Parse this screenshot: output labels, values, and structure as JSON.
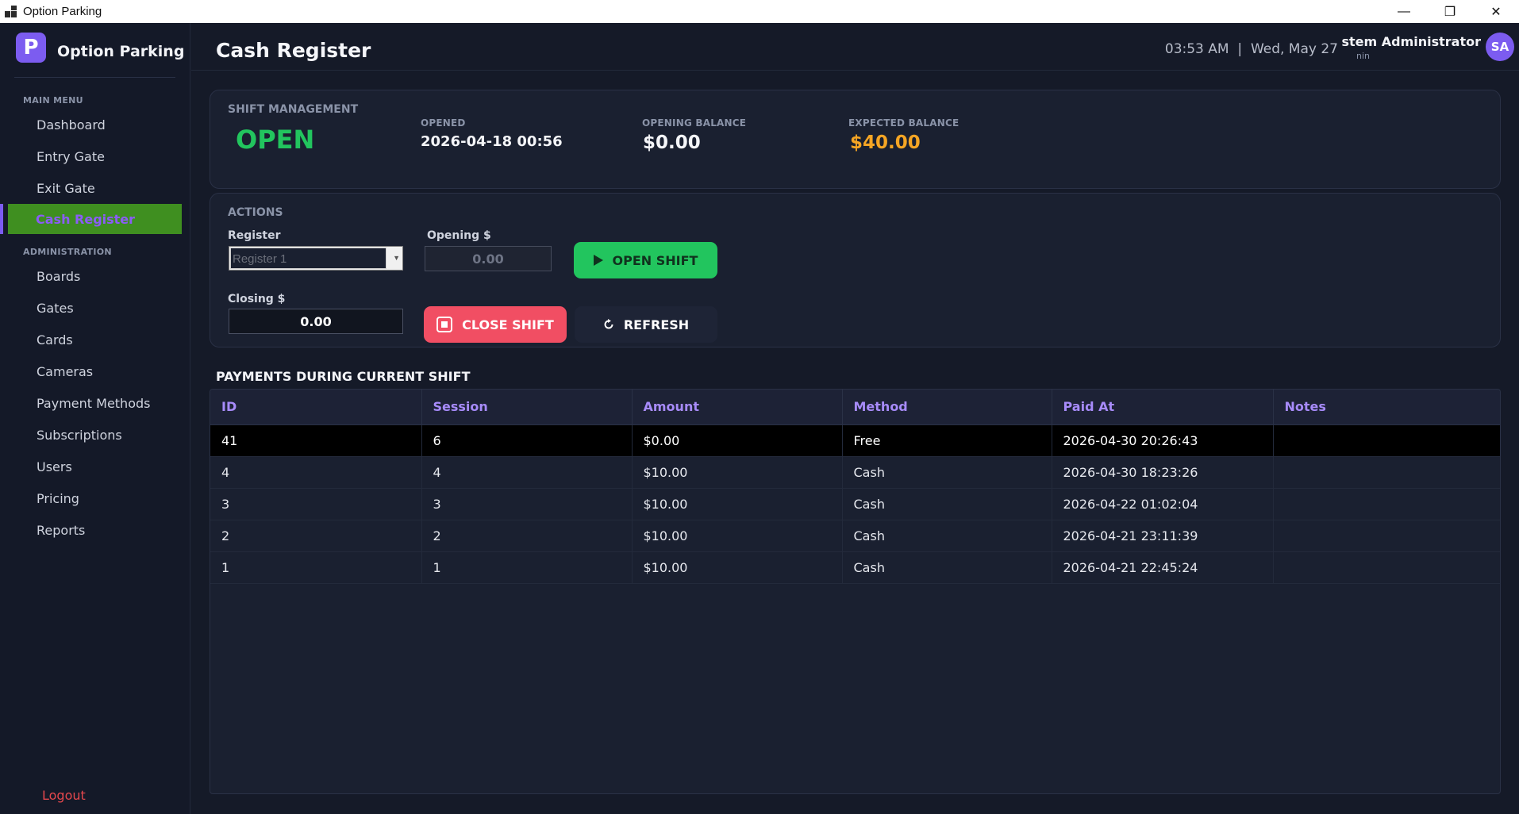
{
  "window": {
    "title": "Option Parking",
    "controls": {
      "minimize": "—",
      "restore": "❐",
      "close": "✕"
    }
  },
  "sidebar": {
    "brand_letter": "P",
    "brand_name": "Option Parking",
    "main_menu_label": "MAIN MENU",
    "main_items": [
      {
        "label": "Dashboard"
      },
      {
        "label": "Entry Gate"
      },
      {
        "label": "Exit Gate"
      },
      {
        "label": "Cash Register",
        "active": true
      }
    ],
    "admin_label": "ADMINISTRATION",
    "admin_items": [
      {
        "label": "Boards"
      },
      {
        "label": "Gates"
      },
      {
        "label": "Cards"
      },
      {
        "label": "Cameras"
      },
      {
        "label": "Payment Methods"
      },
      {
        "label": "Subscriptions"
      },
      {
        "label": "Users"
      },
      {
        "label": "Pricing"
      },
      {
        "label": "Reports"
      }
    ],
    "logout_label": "Logout"
  },
  "header": {
    "title": "Cash Register",
    "time": "03:53 AM",
    "date": "Wed, May 27",
    "user_name": "stem Administrator",
    "user_role": "nin",
    "avatar_initials": "SA"
  },
  "shift": {
    "section_label": "SHIFT MANAGEMENT",
    "status": "OPEN",
    "opened_label": "OPENED",
    "opened_value": "2026-04-18 00:56",
    "opening_balance_label": "OPENING BALANCE",
    "opening_balance_value": "$0.00",
    "expected_balance_label": "EXPECTED BALANCE",
    "expected_balance_value": "$40.00"
  },
  "actions": {
    "section_label": "ACTIONS",
    "register_label": "Register",
    "register_value": "Register 1",
    "opening_label": "Opening $",
    "opening_value": "0.00",
    "closing_label": "Closing $",
    "closing_value": "0.00",
    "open_shift_label": "OPEN SHIFT",
    "close_shift_label": "CLOSE SHIFT",
    "refresh_label": "REFRESH"
  },
  "payments": {
    "title": "PAYMENTS DURING CURRENT SHIFT",
    "columns": [
      "ID",
      "Session",
      "Amount",
      "Method",
      "Paid At",
      "Notes"
    ],
    "rows": [
      [
        "41",
        "6",
        "$0.00",
        "Free",
        "2026-04-30 20:26:43",
        ""
      ],
      [
        "4",
        "4",
        "$10.00",
        "Cash",
        "2026-04-30 18:23:26",
        ""
      ],
      [
        "3",
        "3",
        "$10.00",
        "Cash",
        "2026-04-22 01:02:04",
        ""
      ],
      [
        "2",
        "2",
        "$10.00",
        "Cash",
        "2026-04-21 23:11:39",
        ""
      ],
      [
        "1",
        "1",
        "$10.00",
        "Cash",
        "2026-04-21 22:45:24",
        ""
      ]
    ],
    "selected_row": 0
  },
  "colors": {
    "accent": "#7c5cf0",
    "open_status": "#22c55e",
    "expected_balance": "#f5a524",
    "danger": "#f14e63",
    "active_menu_bg": "#3f8f20"
  }
}
